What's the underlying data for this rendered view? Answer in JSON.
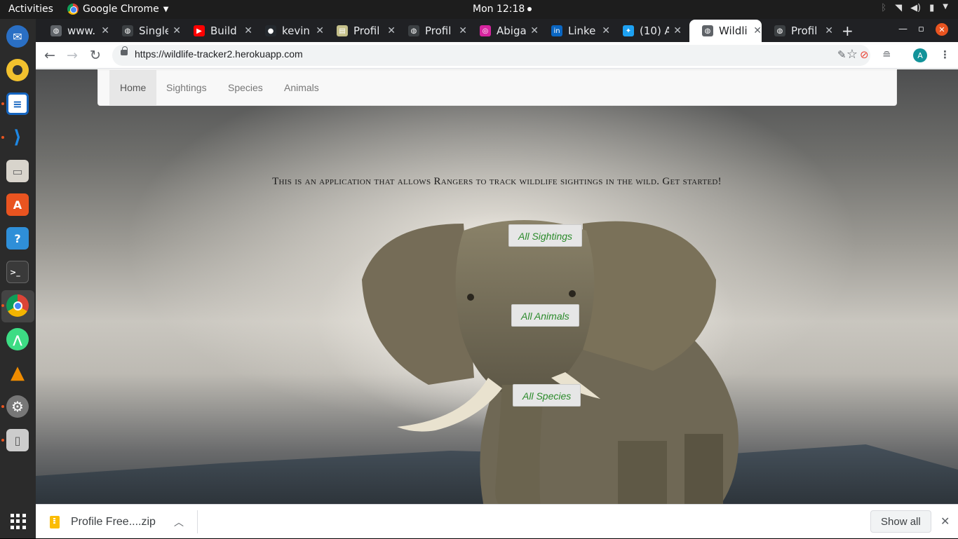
{
  "system": {
    "activities": "Activities",
    "app_name": "Google Chrome",
    "clock": "Mon 12:18"
  },
  "tabs": [
    {
      "title": "www.",
      "favicon": "globe-icon",
      "color": "#5f6368"
    },
    {
      "title": "Single",
      "favicon": "globe-icon",
      "color": "#3c4043"
    },
    {
      "title": "Build",
      "favicon": "youtube-icon",
      "color": "#ff0000"
    },
    {
      "title": "kevin",
      "favicon": "github-icon",
      "color": "#24292e"
    },
    {
      "title": "Profil",
      "favicon": "image-icon",
      "color": "#c5c08a"
    },
    {
      "title": "Profil",
      "favicon": "globe-icon",
      "color": "#3c4043"
    },
    {
      "title": "Abiga",
      "favicon": "instagram-icon",
      "color": "#d6249f"
    },
    {
      "title": "Linke",
      "favicon": "linkedin-icon",
      "color": "#0a66c2"
    },
    {
      "title": "(10) A",
      "favicon": "twitter-icon",
      "color": "#1da1f2"
    },
    {
      "title": "Wildli",
      "favicon": "globe-icon",
      "color": "#5f6368",
      "active": true
    },
    {
      "title": "Profil",
      "favicon": "globe-icon",
      "color": "#3c4043"
    }
  ],
  "omnibox": {
    "url": "https://wildlife-tracker2.herokuapp.com"
  },
  "profile": {
    "initial": "A",
    "color": "#12939a"
  },
  "page": {
    "nav": [
      "Home",
      "Sightings",
      "Species",
      "Animals"
    ],
    "active_nav": "Home",
    "tagline": "This is an application that allows Rangers to track wildlife sightings in the wild. Get started!",
    "buttons": {
      "sightings": "All Sightings",
      "animals": "All Animals",
      "species": "All Species"
    },
    "button_text_color": "#2a8a2a"
  },
  "downloads": {
    "file": "Profile Free....zip",
    "show_all": "Show all"
  }
}
